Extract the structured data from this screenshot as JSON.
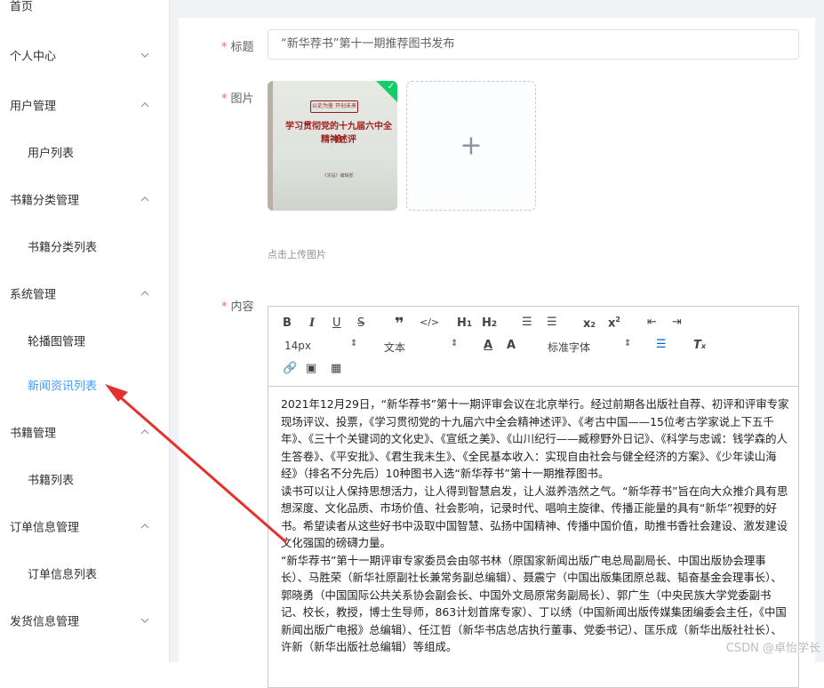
{
  "sidebar": {
    "items": [
      {
        "label": "首页"
      },
      {
        "label": "个人中心"
      },
      {
        "label": "用户管理",
        "sub": [
          "用户列表"
        ]
      },
      {
        "label": "书籍分类管理",
        "sub": [
          "书籍分类列表"
        ]
      },
      {
        "label": "系统管理",
        "sub": [
          "轮播图管理",
          "新闻资讯列表"
        ]
      },
      {
        "label": "书籍管理",
        "sub": [
          "书籍列表"
        ]
      },
      {
        "label": "订单信息管理",
        "sub": [
          "订单信息列表"
        ]
      },
      {
        "label": "发货信息管理"
      }
    ],
    "active": "新闻资讯列表"
  },
  "form": {
    "title_label": "标题",
    "title_value": "“新华荐书”第十一期推荐图书发布",
    "image_label": "图片",
    "upload_hint": "点击上传图片",
    "content_label": "内容"
  },
  "book_cover": {
    "tag": "以史为鉴 开创未来",
    "title_line1": "学习贯彻党的十九届六中全会",
    "title_line2": "精神述评",
    "spine": "学习贯彻党的十九届六中全会精神述评",
    "publisher": "《求是》编辑部"
  },
  "toolbar": {
    "font_size": "14px",
    "paragraph": "文本",
    "font_family": "标准字体"
  },
  "editor": {
    "paragraphs": [
      "2021年12月29日，“新华荐书”第十一期评审会议在北京举行。经过前期各出版社自荐、初评和评审专家现场评议、投票，《学习贯彻党的十九届六中全会精神述评》、《考古中国——15位考古学家说上下五千年》、《三十个关键词的文化史》、《宣纸之美》、《山川纪行——臧穆野外日记》、《科学与忠诚：钱学森的人生答卷》、《平安批》、《君生我未生》、《全民基本收入：实现自由社会与健全经济的方案》、《少年读山海经》（排名不分先后）10种图书入选“新华荐书”第十一期推荐图书。",
      "读书可以让人保持思想活力，让人得到智慧启发，让人滋养浩然之气。“新华荐书”旨在向大众推介具有思想深度、文化品质、市场价值、社会影响，记录时代、唱响主旋律、传播正能量的具有“新华”视野的好书。希望读者从这些好书中汲取中国智慧、弘扬中国精神、传播中国价值，助推书香社会建设、激发建设文化强国的磅礴力量。",
      "“新华荐书”第十一期评审专家委员会由邬书林（原国家新闻出版广电总局副局长、中国出版协会理事长）、马胜荣（新华社原副社长兼常务副总编辑）、聂震宁（中国出版集团原总裁、韬奋基金会理事长）、郭晓勇（中国国际公共关系协会副会长、中国外文局原常务副局长）、郭广生（中央民族大学党委副书记、校长，教授，博士生导师，863计划首席专家）、丁以绣（中国新闻出版传媒集团编委会主任，《中国新闻出版广电报》总编辑）、任江哲（新华书店总店执行董事、党委书记）、匡乐成（新华出版社社长）、许新（新华出版社总编辑）等组成。"
    ]
  },
  "watermark": "CSDN @卓怡学长",
  "colors": {
    "active": "#409EFF",
    "required": "#f56c6c",
    "arrow": "#e5312e"
  }
}
